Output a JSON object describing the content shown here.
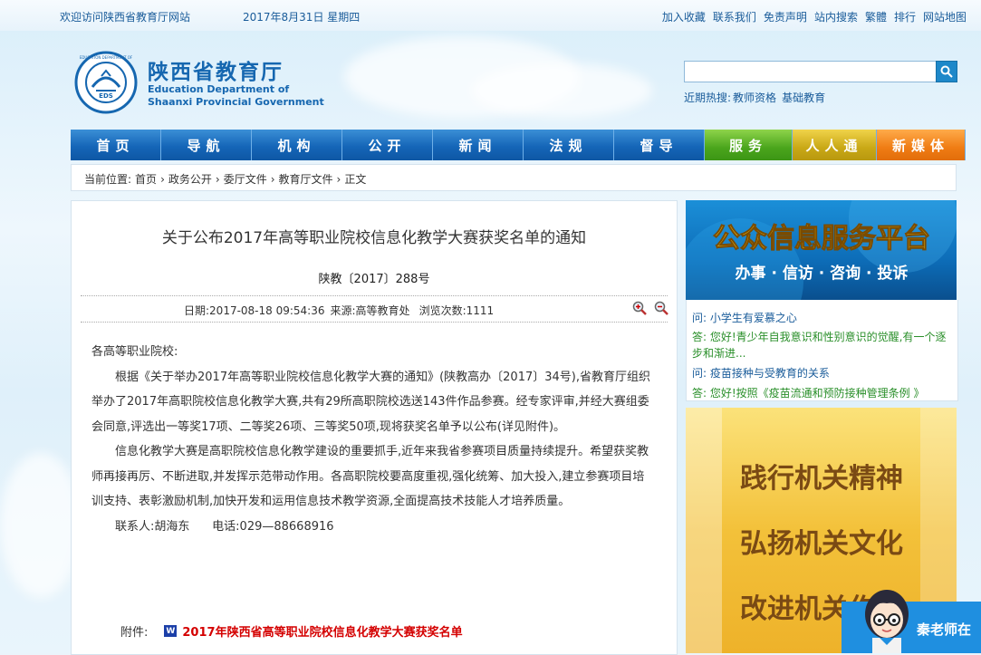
{
  "topbar": {
    "welcome": "欢迎访问陕西省教育厅网站",
    "date": "2017年8月31日 星期四",
    "links": [
      "加入收藏",
      "联系我们",
      "免责声明",
      "站内搜索",
      "繁體",
      "排行",
      "网站地图"
    ]
  },
  "header": {
    "org_cn": "陕西省教育厅",
    "org_en_line1": "Education Department of",
    "org_en_line2": "Shaanxi Provincial Government",
    "logo_text_top": "EDUCATION DEPARTMENT OF",
    "logo_text_center": "EDS"
  },
  "search": {
    "placeholder": "",
    "hot_label": "近期热搜:",
    "hot_terms": [
      "教师资格",
      "基础教育"
    ]
  },
  "nav": [
    {
      "label": "首页",
      "color": "blue"
    },
    {
      "label": "导航",
      "color": "blue"
    },
    {
      "label": "机构",
      "color": "blue"
    },
    {
      "label": "公开",
      "color": "blue"
    },
    {
      "label": "新闻",
      "color": "blue"
    },
    {
      "label": "法规",
      "color": "blue"
    },
    {
      "label": "督导",
      "color": "blue"
    },
    {
      "label": "服务",
      "color": "green"
    },
    {
      "label": "人人通",
      "color": "yellow"
    },
    {
      "label": "新媒体",
      "color": "orange"
    }
  ],
  "breadcrumb": {
    "prefix": "当前位置:",
    "items": [
      "首页",
      "政务公开",
      "委厅文件",
      "教育厅文件",
      "正文"
    ],
    "separator": "›"
  },
  "article": {
    "title": "关于公布2017年高等职业院校信息化教学大赛获奖名单的通知",
    "doc_number": "陕教〔2017〕288号",
    "meta_date_label": "日期:",
    "meta_date": "2017-08-18 09:54:36",
    "meta_source_label": "来源:",
    "meta_source": "高等教育处",
    "meta_views_label": "浏览次数:",
    "meta_views": "1111",
    "salutation": "各高等职业院校:",
    "para1": "根据《关于举办2017年高等职业院校信息化教学大赛的通知》(陕教高办〔2017〕34号),省教育厅组织举办了2017年高职院校信息化教学大赛,共有29所高职院校选送143件作品参赛。经专家评审,并经大赛组委会同意,评选出一等奖17项、二等奖26项、三等奖50项,现将获奖名单予以公布(详见附件)。",
    "para2": "信息化教学大赛是高职院校信息化教学建设的重要抓手,近年来我省参赛项目质量持续提升。希望获奖教师再接再厉、不断进取,并发挥示范带动作用。各高职院校要高度重视,强化统筹、加大投入,建立参赛项目培训支持、表彰激励机制,加快开发和运用信息技术教学资源,全面提高技术技能人才培养质量。",
    "contact": "联系人:胡海东      电话:029—88668916",
    "attach_label": "附件:",
    "attach_icon": "W",
    "attach_title": "2017年陕西省高等职业院校信息化教学大赛获奖名单"
  },
  "sidebar": {
    "banner1_title": "公众信息服务平台",
    "banner1_sub": "办事 · 信访 · 咨询 · 投诉",
    "qa": [
      {
        "type": "q",
        "text": "问: 小学生有爱慕之心"
      },
      {
        "type": "a",
        "text": "答: 您好!青少年自我意识和性别意识的觉醒,有一个逐步和渐进..."
      },
      {
        "type": "q",
        "text": "问: 疫苗接种与受教育的关系"
      },
      {
        "type": "a",
        "text": "答: 您好!按照《疫苗流通和预防接种管理条例 》"
      }
    ],
    "banner2_lines": [
      "践行机关精神",
      "弘扬机关文化",
      "改进机关作风"
    ]
  },
  "float_widget": {
    "label": "秦老师在"
  },
  "colors": {
    "brand_blue": "#1667b0",
    "link_blue": "#1a5c9a",
    "answer_green": "#2a8f2a",
    "attach_red": "#d40000"
  }
}
